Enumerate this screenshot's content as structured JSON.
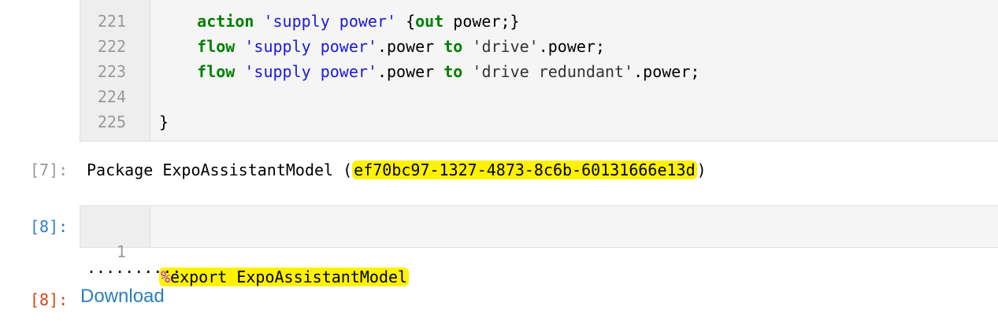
{
  "cell_top": {
    "lines": [
      {
        "num": "221",
        "indent": "    ",
        "parts": [
          {
            "t": "action",
            "c": "kw"
          },
          {
            "t": " ",
            "c": ""
          },
          {
            "t": "'supply power'",
            "c": "str"
          },
          {
            "t": " {",
            "c": ""
          },
          {
            "t": "out",
            "c": "kw"
          },
          {
            "t": " power;}",
            "c": ""
          }
        ]
      },
      {
        "num": "222",
        "indent": "    ",
        "parts": [
          {
            "t": "flow",
            "c": "kw"
          },
          {
            "t": " ",
            "c": ""
          },
          {
            "t": "'supply power'",
            "c": "str"
          },
          {
            "t": ".power ",
            "c": ""
          },
          {
            "t": "to",
            "c": "kw"
          },
          {
            "t": " ",
            "c": ""
          },
          {
            "t": "'drive'",
            "c": "str2"
          },
          {
            "t": ".power;",
            "c": ""
          }
        ]
      },
      {
        "num": "223",
        "indent": "    ",
        "parts": [
          {
            "t": "flow",
            "c": "kw"
          },
          {
            "t": " ",
            "c": ""
          },
          {
            "t": "'supply power'",
            "c": "str"
          },
          {
            "t": ".power ",
            "c": ""
          },
          {
            "t": "to",
            "c": "kw"
          },
          {
            "t": " ",
            "c": ""
          },
          {
            "t": "'drive redundant'",
            "c": "str2"
          },
          {
            "t": ".power;",
            "c": ""
          }
        ]
      },
      {
        "num": "224",
        "indent": "",
        "parts": []
      },
      {
        "num": "225",
        "indent": "",
        "parts": [
          {
            "t": "}",
            "c": ""
          }
        ]
      }
    ]
  },
  "output_7": {
    "prompt": "[7]:",
    "prefix": "Package ExpoAssistantModel (",
    "uuid": "ef70bc97-1327-4873-8c6b-60131666e13d",
    "suffix": ")"
  },
  "cell_8": {
    "prompt": "[8]:",
    "line_num": "1",
    "magic": "%",
    "command": "export ExpoAssistantModel"
  },
  "output_8": {
    "progress": "..........",
    "prompt": "[8]:",
    "link_label": "Download"
  }
}
